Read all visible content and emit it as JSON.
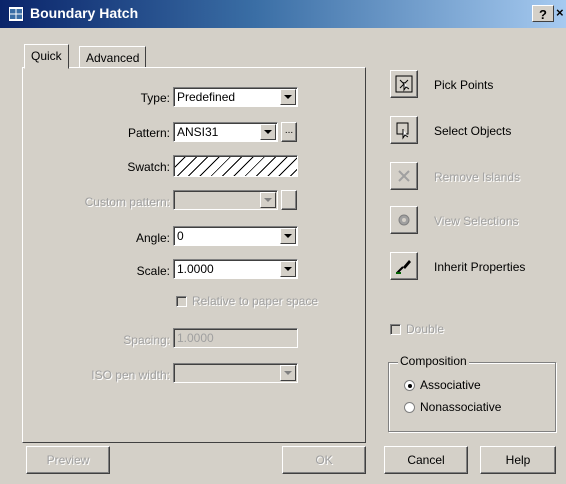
{
  "window": {
    "title": "Boundary Hatch",
    "help_label": "?",
    "close_label": "×"
  },
  "tabs": [
    {
      "label": "Quick"
    },
    {
      "label": "Advanced"
    }
  ],
  "quick": {
    "type": {
      "label": "Type:",
      "value": "Predefined"
    },
    "pattern": {
      "label": "Pattern:",
      "value": "ANSI31",
      "browse": "..."
    },
    "swatch": {
      "label": "Swatch:"
    },
    "custom_pattern": {
      "label": "Custom pattern:",
      "value": ""
    },
    "angle": {
      "label": "Angle:",
      "value": "0"
    },
    "scale": {
      "label": "Scale:",
      "value": "1.0000"
    },
    "relative_to_paper": {
      "label": "Relative to paper space",
      "checked": false
    },
    "spacing": {
      "label": "Spacing:",
      "value": "1.0000"
    },
    "iso_pen": {
      "label": "ISO pen width:",
      "value": ""
    }
  },
  "side": {
    "pick_points": "Pick Points",
    "select_objects": "Select Objects",
    "remove_islands": "Remove Islands",
    "view_selections": "View Selections",
    "inherit_properties": "Inherit Properties",
    "double": {
      "label": "Double",
      "checked": false
    },
    "composition": {
      "title": "Composition",
      "associative": "Associative",
      "nonassociative": "Nonassociative",
      "selected": "Associative"
    }
  },
  "footer": {
    "preview": "Preview",
    "ok": "OK",
    "cancel": "Cancel",
    "help": "Help"
  }
}
